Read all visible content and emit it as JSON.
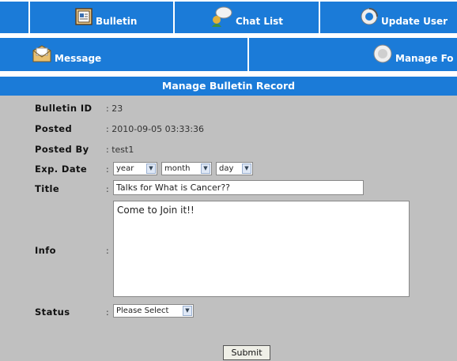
{
  "nav": {
    "row1": [
      {
        "label": "Bulletin",
        "icon": "bulletin-icon"
      },
      {
        "label": "Chat List",
        "icon": "chat-icon"
      },
      {
        "label": "Update User",
        "icon": "update-icon"
      }
    ],
    "row2": [
      {
        "label": "Message",
        "icon": "message-icon"
      },
      {
        "label": "Manage Fo",
        "icon": "manage-icon"
      }
    ]
  },
  "header": {
    "title": "Manage Bulletin Record"
  },
  "form": {
    "bulletin_id": {
      "label": "Bulletin ID",
      "value": ": 23"
    },
    "posted": {
      "label": "Posted",
      "value": ": 2010-09-05 03:33:36"
    },
    "posted_by": {
      "label": "Posted By",
      "value": ": test1"
    },
    "exp_date": {
      "label": "Exp. Date",
      "colon": ":",
      "year": "year",
      "month": "month",
      "day": "day"
    },
    "title": {
      "label": "Title",
      "colon": ":",
      "value": "Talks for What is Cancer??"
    },
    "info": {
      "label": "Info",
      "colon": ":",
      "value": "Come to Join it!!"
    },
    "status": {
      "label": "Status",
      "colon": ":",
      "value": "Please Select"
    },
    "submit_label": "Submit"
  },
  "colors": {
    "nav_blue": "#1b7bd8",
    "form_bg": "#c0c0c0"
  }
}
